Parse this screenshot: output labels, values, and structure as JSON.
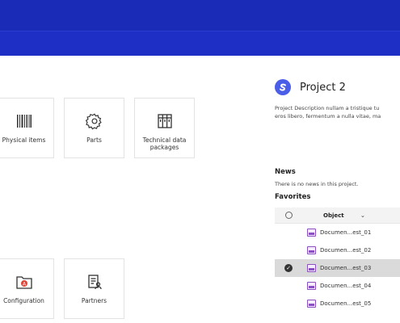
{
  "tiles": [
    {
      "label": "Physical items",
      "icon": "barcode-icon"
    },
    {
      "label": "Parts",
      "icon": "gear-icon"
    },
    {
      "label": "Technical data packages",
      "icon": "archive-icon"
    },
    {
      "label": "Configuration",
      "icon": "folder-config-icon"
    },
    {
      "label": "Partners",
      "icon": "partners-icon"
    }
  ],
  "project": {
    "title": "Project 2",
    "description_line1": "Project Description nullam a tristique tu",
    "description_line2": "eros libero, fermentum a nulla vitae, ma"
  },
  "news": {
    "heading": "News",
    "text": "There is no news in this project."
  },
  "favorites": {
    "heading": "Favorites",
    "column_object": "Object",
    "rows": [
      {
        "name": "Documen...est_01",
        "selected": false
      },
      {
        "name": "Documen...est_02",
        "selected": false
      },
      {
        "name": "Documen...est_03",
        "selected": true
      },
      {
        "name": "Documen...est_04",
        "selected": false
      },
      {
        "name": "Documen...est_05",
        "selected": false
      }
    ]
  },
  "colors": {
    "header": "#1a2bb8",
    "accent": "#4a5ee8",
    "selected_row": "#dadada"
  }
}
